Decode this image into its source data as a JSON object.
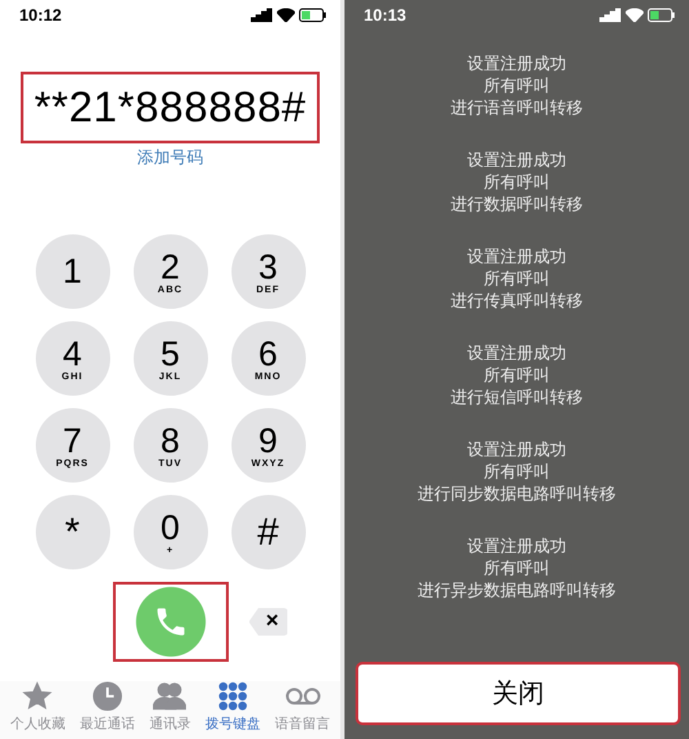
{
  "dialer": {
    "status_bar": {
      "time": "10:12"
    },
    "number_field": {
      "value": "**21*888888#",
      "highlighted": true
    },
    "add_number_link": "添加号码",
    "keys": [
      {
        "digit": "1"
      },
      {
        "digit": "2",
        "letters": "ABC"
      },
      {
        "digit": "3",
        "letters": "DEF"
      },
      {
        "digit": "4",
        "letters": "GHI"
      },
      {
        "digit": "5",
        "letters": "JKL"
      },
      {
        "digit": "6",
        "letters": "MNO"
      },
      {
        "digit": "7",
        "letters": "PQRS"
      },
      {
        "digit": "8",
        "letters": "TUV"
      },
      {
        "digit": "9",
        "letters": "WXYZ"
      },
      {
        "digit": "*"
      },
      {
        "digit": "0",
        "letters": "+"
      },
      {
        "digit": "#"
      }
    ],
    "call_button": {
      "highlighted": true
    },
    "delete_button": {
      "label": "×"
    },
    "tab_bar": [
      {
        "label": "个人收藏",
        "kind": "favorites",
        "selected": false
      },
      {
        "label": "最近通话",
        "kind": "recents",
        "selected": false
      },
      {
        "label": "通讯录",
        "kind": "contacts",
        "selected": false
      },
      {
        "label": "拨号键盘",
        "kind": "keypad",
        "selected": true
      },
      {
        "label": "语音留言",
        "kind": "voicemail",
        "selected": false
      }
    ]
  },
  "result": {
    "status_bar": {
      "time": "10:13"
    },
    "messages": [
      [
        "设置注册成功",
        "所有呼叫",
        "进行语音呼叫转移"
      ],
      [
        "设置注册成功",
        "所有呼叫",
        "进行数据呼叫转移"
      ],
      [
        "设置注册成功",
        "所有呼叫",
        "进行传真呼叫转移"
      ],
      [
        "设置注册成功",
        "所有呼叫",
        "进行短信呼叫转移"
      ],
      [
        "设置注册成功",
        "所有呼叫",
        "进行同步数据电路呼叫转移"
      ],
      [
        "设置注册成功",
        "所有呼叫",
        "进行异步数据电路呼叫转移"
      ]
    ],
    "close_button": {
      "label": "关闭",
      "highlighted": true
    }
  }
}
